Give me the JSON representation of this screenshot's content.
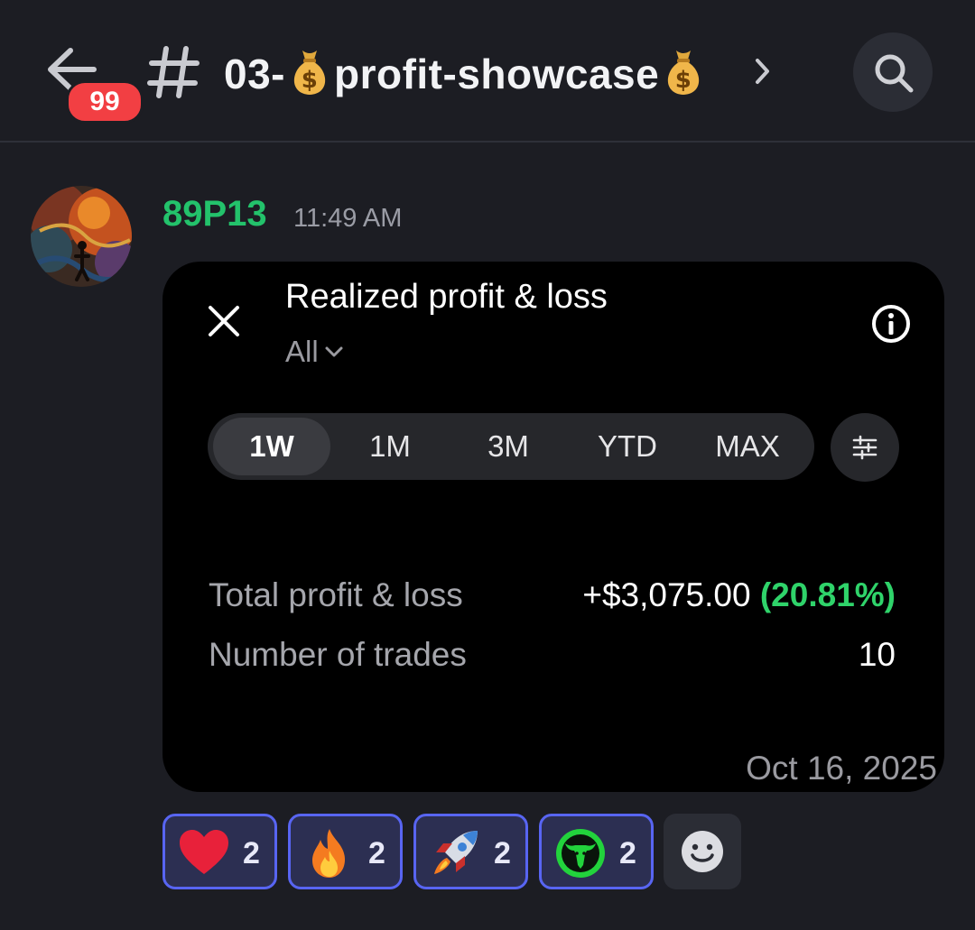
{
  "header": {
    "unread_count": "99",
    "channel_prefix": "03-",
    "channel_suffix": "profit-showcase",
    "channel_emoji": "money-bag-icon"
  },
  "message": {
    "username": "89P13",
    "timestamp": "11:49 AM",
    "username_color": "#23c26b"
  },
  "card": {
    "title": "Realized profit & loss",
    "filter": "All",
    "tabs": [
      "1W",
      "1M",
      "3M",
      "YTD",
      "MAX"
    ],
    "active_tab": "1W",
    "rows": {
      "total_label": "Total profit & loss",
      "total_value": "+$3,075.00",
      "total_pct": "(20.81%)",
      "trades_label": "Number of trades",
      "trades_value": "10"
    },
    "date": "Oct 16, 2025"
  },
  "reactions": [
    {
      "icon": "heart-icon",
      "count": "2"
    },
    {
      "icon": "fire-icon",
      "count": "2"
    },
    {
      "icon": "rocket-icon",
      "count": "2"
    },
    {
      "icon": "bull-icon",
      "count": "2"
    }
  ],
  "colors": {
    "background": "#1c1d23",
    "accent": "#5865f2",
    "profit_green": "#2fd36a",
    "badge_red": "#f23f43"
  }
}
